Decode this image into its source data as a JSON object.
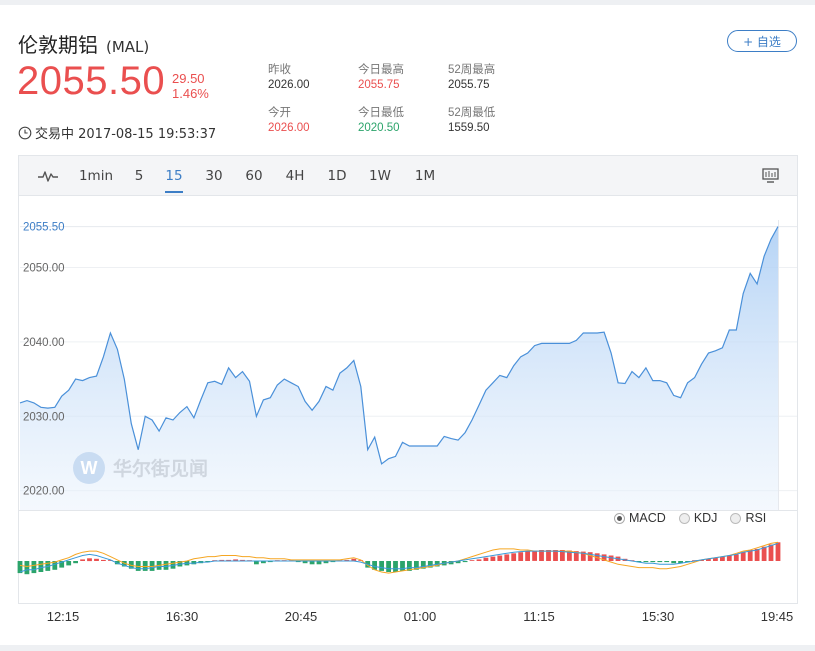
{
  "header": {
    "name": "伦敦期铝",
    "code": "(MAL)",
    "add_label": "+ 自选",
    "price": "2055.50",
    "change": "29.50",
    "change_pct": "1.46%",
    "status_text": "交易中 2017-08-15 19:53:37"
  },
  "stats": [
    {
      "label": "昨收",
      "value": "2026.00"
    },
    {
      "label": "今日最高",
      "value": "2055.75"
    },
    {
      "label": "52周最高",
      "value": "2055.75"
    },
    {
      "label": "今开",
      "value": "2026.00"
    },
    {
      "label": "今日最低",
      "value": "2020.50"
    },
    {
      "label": "52周最低",
      "value": "1559.50"
    }
  ],
  "tabs": [
    {
      "label": "1min"
    },
    {
      "label": "5"
    },
    {
      "label": "15",
      "active": true
    },
    {
      "label": "30"
    },
    {
      "label": "60"
    },
    {
      "label": "4H"
    },
    {
      "label": "1D"
    },
    {
      "label": "1W"
    },
    {
      "label": "1M"
    }
  ],
  "indicators": [
    "MACD",
    "KDJ",
    "RSI"
  ],
  "indicator_selected": "MACD",
  "watermark": "华尔街见闻",
  "colors": {
    "up": "#ea4f4f",
    "down": "#2ca46b",
    "accent": "#3d7ec6",
    "line": "#4a90d9",
    "dif": "#3a9ad9",
    "dea": "#f5a623"
  },
  "chart_data": {
    "type": "area",
    "x_labels": [
      "12:15",
      "16:30",
      "20:45",
      "01:00",
      "11:15",
      "15:30",
      "19:45"
    ],
    "y_ticks": [
      2020,
      2030,
      2040,
      2050
    ],
    "y_tick_labels": [
      "2020.00",
      "2030.00",
      "2040.00",
      "2050.00"
    ],
    "last_label": "2055.50",
    "ylim": [
      2017.4,
      2058.4
    ],
    "x_count": 110,
    "series": [
      {
        "values": [
          2031.8,
          2032.1,
          2031.8,
          2031.2,
          2031.1,
          2031.2,
          2032.7,
          2033.5,
          2035.0,
          2034.8,
          2035.2,
          2035.4,
          2038.0,
          2041.2,
          2039.0,
          2035.0,
          2029.0,
          2025.5,
          2030.0,
          2029.5,
          2028.0,
          2029.8,
          2029.5,
          2030.5,
          2031.3,
          2029.8,
          2032.2,
          2034.5,
          2034.7,
          2034.3,
          2036.5,
          2035.2,
          2036.0,
          2034.7,
          2030.0,
          2032.2,
          2032.5,
          2034.2,
          2035.0,
          2034.5,
          2034.0,
          2032.0,
          2030.8,
          2032.0,
          2034.0,
          2033.5,
          2035.8,
          2036.5,
          2037.5,
          2034.0,
          2025.5,
          2027.2,
          2023.6,
          2024.3,
          2024.6,
          2026.5,
          2026.0,
          2026.0,
          2026.0,
          2026.0,
          2026.0,
          2027.3,
          2027.0,
          2026.8,
          2027.8,
          2029.5,
          2031.5,
          2033.5,
          2034.5,
          2035.5,
          2035.2,
          2036.8,
          2038.0,
          2038.5,
          2039.5,
          2039.8,
          2039.8,
          2039.8,
          2039.8,
          2039.8,
          2040.2,
          2041.2,
          2041.2,
          2041.2,
          2041.3,
          2038.5,
          2034.5,
          2034.4,
          2036.0,
          2035.2,
          2036.5,
          2034.8,
          2034.8,
          2034.5,
          2032.8,
          2032.5,
          2034.5,
          2035.2,
          2037.0,
          2038.5,
          2038.8,
          2039.2,
          2041.6,
          2041.6,
          2046.5,
          2049.2,
          2047.8,
          2051.5,
          2053.8,
          2055.5
        ]
      }
    ],
    "macd": {
      "indicator": "MACD",
      "hist": [
        -1.1,
        -1.2,
        -1.1,
        -1,
        -0.9,
        -0.8,
        -0.6,
        -0.4,
        -0.2,
        0.15,
        0.25,
        0.2,
        0.1,
        0,
        -0.3,
        -0.5,
        -0.7,
        -0.9,
        -0.9,
        -0.9,
        -0.8,
        -0.8,
        -0.7,
        -0.5,
        -0.4,
        -0.3,
        -0.2,
        -0.1,
        0.05,
        0.1,
        0.1,
        0.15,
        0.1,
        0,
        -0.3,
        -0.2,
        -0.1,
        0,
        0,
        0,
        -0.1,
        -0.2,
        -0.3,
        -0.3,
        -0.2,
        -0.1,
        0,
        0.1,
        0.2,
        0,
        -0.6,
        -0.8,
        -0.9,
        -1,
        -1,
        -0.9,
        -0.9,
        -0.8,
        -0.7,
        -0.6,
        -0.5,
        -0.4,
        -0.3,
        -0.2,
        -0.1,
        0,
        0.15,
        0.3,
        0.4,
        0.5,
        0.6,
        0.7,
        0.8,
        0.9,
        0.95,
        1,
        1,
        1,
        1,
        0.95,
        0.9,
        0.85,
        0.8,
        0.7,
        0.6,
        0.5,
        0.4,
        0.2,
        0,
        -0.1,
        -0.1,
        -0.1,
        -0.1,
        -0.1,
        -0.2,
        -0.2,
        -0.1,
        0,
        0.1,
        0.2,
        0.3,
        0.4,
        0.5,
        0.6,
        0.8,
        1,
        1.1,
        1.3,
        1.5,
        1.7
      ],
      "dif": [
        -1,
        -0.8,
        -0.8,
        -0.6,
        -0.5,
        -0.3,
        -0.1,
        0.1,
        0.3,
        0.5,
        0.6,
        0.5,
        0.3,
        0.1,
        -0.2,
        -0.4,
        -0.6,
        -0.7,
        -0.7,
        -0.6,
        -0.5,
        -0.5,
        -0.4,
        -0.3,
        -0.2,
        -0.2,
        -0.1,
        -0.1,
        0,
        0,
        0,
        0,
        0,
        0,
        0,
        0,
        0,
        0,
        0,
        0,
        0,
        0,
        0,
        0,
        0,
        0,
        0,
        0,
        0,
        -0.1,
        -0.3,
        -0.5,
        -0.6,
        -0.7,
        -0.7,
        -0.7,
        -0.6,
        -0.6,
        -0.5,
        -0.4,
        -0.3,
        -0.2,
        -0.1,
        0,
        0.1,
        0.2,
        0.3,
        0.4,
        0.5,
        0.6,
        0.7,
        0.8,
        0.85,
        0.9,
        0.9,
        0.9,
        0.9,
        0.9,
        0.85,
        0.8,
        0.75,
        0.7,
        0.6,
        0.5,
        0.4,
        0.3,
        0.2,
        0.1,
        0,
        -0.1,
        -0.2,
        -0.2,
        -0.3,
        -0.3,
        -0.3,
        -0.2,
        -0.1,
        0,
        0.1,
        0.2,
        0.3,
        0.4,
        0.5,
        0.6,
        0.8,
        0.9,
        1,
        1.2,
        1.4,
        1.6
      ],
      "dea": [
        -0.4,
        -0.5,
        -0.4,
        -0.3,
        -0.2,
        -0.1,
        0.1,
        0.3,
        0.6,
        0.8,
        0.9,
        0.9,
        0.7,
        0.4,
        0.1,
        -0.2,
        -0.4,
        -0.5,
        -0.5,
        -0.5,
        -0.4,
        -0.3,
        -0.2,
        -0.1,
        0,
        0.2,
        0.3,
        0.4,
        0.4,
        0.5,
        0.5,
        0.5,
        0.4,
        0.4,
        0.3,
        0.3,
        0.2,
        0.2,
        0.2,
        0.1,
        0.1,
        0.1,
        0.1,
        0.1,
        0.1,
        0.1,
        0.1,
        0.2,
        0.3,
        0.1,
        -0.4,
        -0.8,
        -1,
        -1.1,
        -1,
        -0.9,
        -0.8,
        -0.7,
        -0.6,
        -0.5,
        -0.4,
        -0.2,
        -0.1,
        0,
        0.2,
        0.4,
        0.6,
        0.8,
        1,
        1.1,
        1.1,
        1.1,
        1,
        1,
        0.9,
        0.9,
        0.9,
        0.9,
        0.9,
        0.9,
        0.8,
        0.7,
        0.5,
        0.3,
        0.1,
        -0.1,
        -0.3,
        -0.4,
        -0.5,
        -0.6,
        -0.6,
        -0.6,
        -0.7,
        -0.7,
        -0.6,
        -0.5,
        -0.3,
        -0.1,
        0.1,
        0.2,
        0.3,
        0.4,
        0.5,
        0.7,
        0.9,
        1,
        1.2,
        1.4,
        1.6,
        1.7
      ]
    }
  }
}
